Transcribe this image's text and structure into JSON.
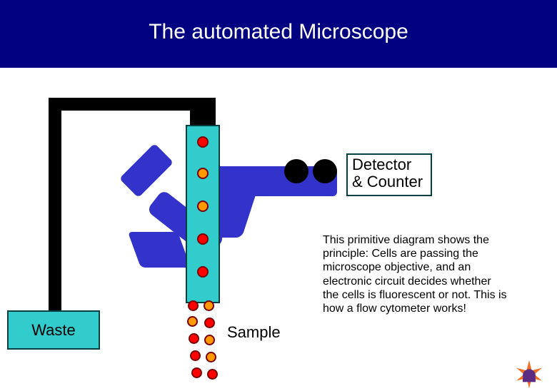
{
  "title": "The automated Microscope",
  "labels": {
    "waste": "Waste",
    "sample": "Sample",
    "detector_line1": "Detector",
    "detector_line2": "& Counter"
  },
  "description": "This primitive diagram shows the principle: Cells are passing the microscope objective, and an electronic circuit decides whether the cells is fluorescent or not. This is how a flow cytometer works!",
  "colors": {
    "title_bg": "#000080",
    "teal": "#33cccc",
    "scope_blue": "#3333cc",
    "cell_red": "#ff0000",
    "cell_orange": "#ff9900",
    "logo_orange": "#f36f21",
    "logo_purple": "#5a2d82"
  }
}
